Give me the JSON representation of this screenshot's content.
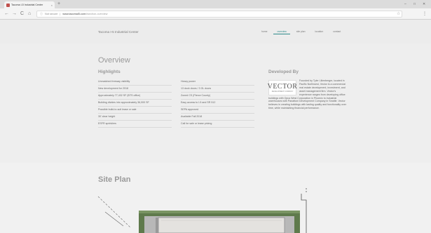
{
  "browser": {
    "tab_title": "Tacoma I-5 Industrial Center",
    "tab_close": "×",
    "new_tab": "+",
    "controls": {
      "minimize": "–",
      "maximize": "□",
      "close": "✕"
    },
    "nav": {
      "back": "←",
      "forward": "→",
      "reload": "C",
      "home": "⌂"
    },
    "security": "Not secure",
    "url_host": "www.tacomai5.com",
    "url_path": "/#section-overview",
    "icons": [
      "info-icon",
      "star-icon",
      "menu-icon"
    ]
  },
  "site": {
    "title": "Tacoma I-5 Industrial Center",
    "nav": [
      "HOME",
      "OVERVIEW",
      "SITE PLAN",
      "LOCATION",
      "CONTACT"
    ],
    "active_nav": "OVERVIEW"
  },
  "overview": {
    "title": "Overview",
    "highlights_title": "Highlights",
    "highlights_left": [
      "Unmatched freeway visibility",
      "New development for 2018",
      "Approximately 77,432 SF (BTS office)",
      "Building divides into approximately 36,000 SF",
      "Possible build-to-suit lease or sale",
      "30' clear height",
      "ESFR sprinklers"
    ],
    "highlights_right": [
      "Heavy power",
      "13 dock doors / 3 GL doors",
      "Zoned CS (Pierce County)",
      "Easy access to I-5 and SR 512",
      "SEPA approved",
      "Available Fall 2018",
      "Call for sale or lease pricing"
    ],
    "developer": {
      "title": "Developed By",
      "logo_text": "VECTOR",
      "logo_sub": "DEVELOPMENT COMPANY",
      "description": "Founded by Tyler Lilienberger, located in Pacific Northwest, Vector is a commercial real estate development, investment, and asset management firm. Vector's experience ranges from developing office buildings with Opus West Corporation in Phoenix to industrial warehouses with Panattoni Development Company in Seattle. Vector believes in creating buildings with lasting quality and functionality over time, while maintaining financial performance."
    }
  },
  "site_plan": {
    "title": "Site Plan"
  },
  "colors": {
    "accent": "#2e8a8a",
    "page_bg": "#eeeeee",
    "building": "#e4e2df",
    "landscape": "#5f7a4c"
  }
}
